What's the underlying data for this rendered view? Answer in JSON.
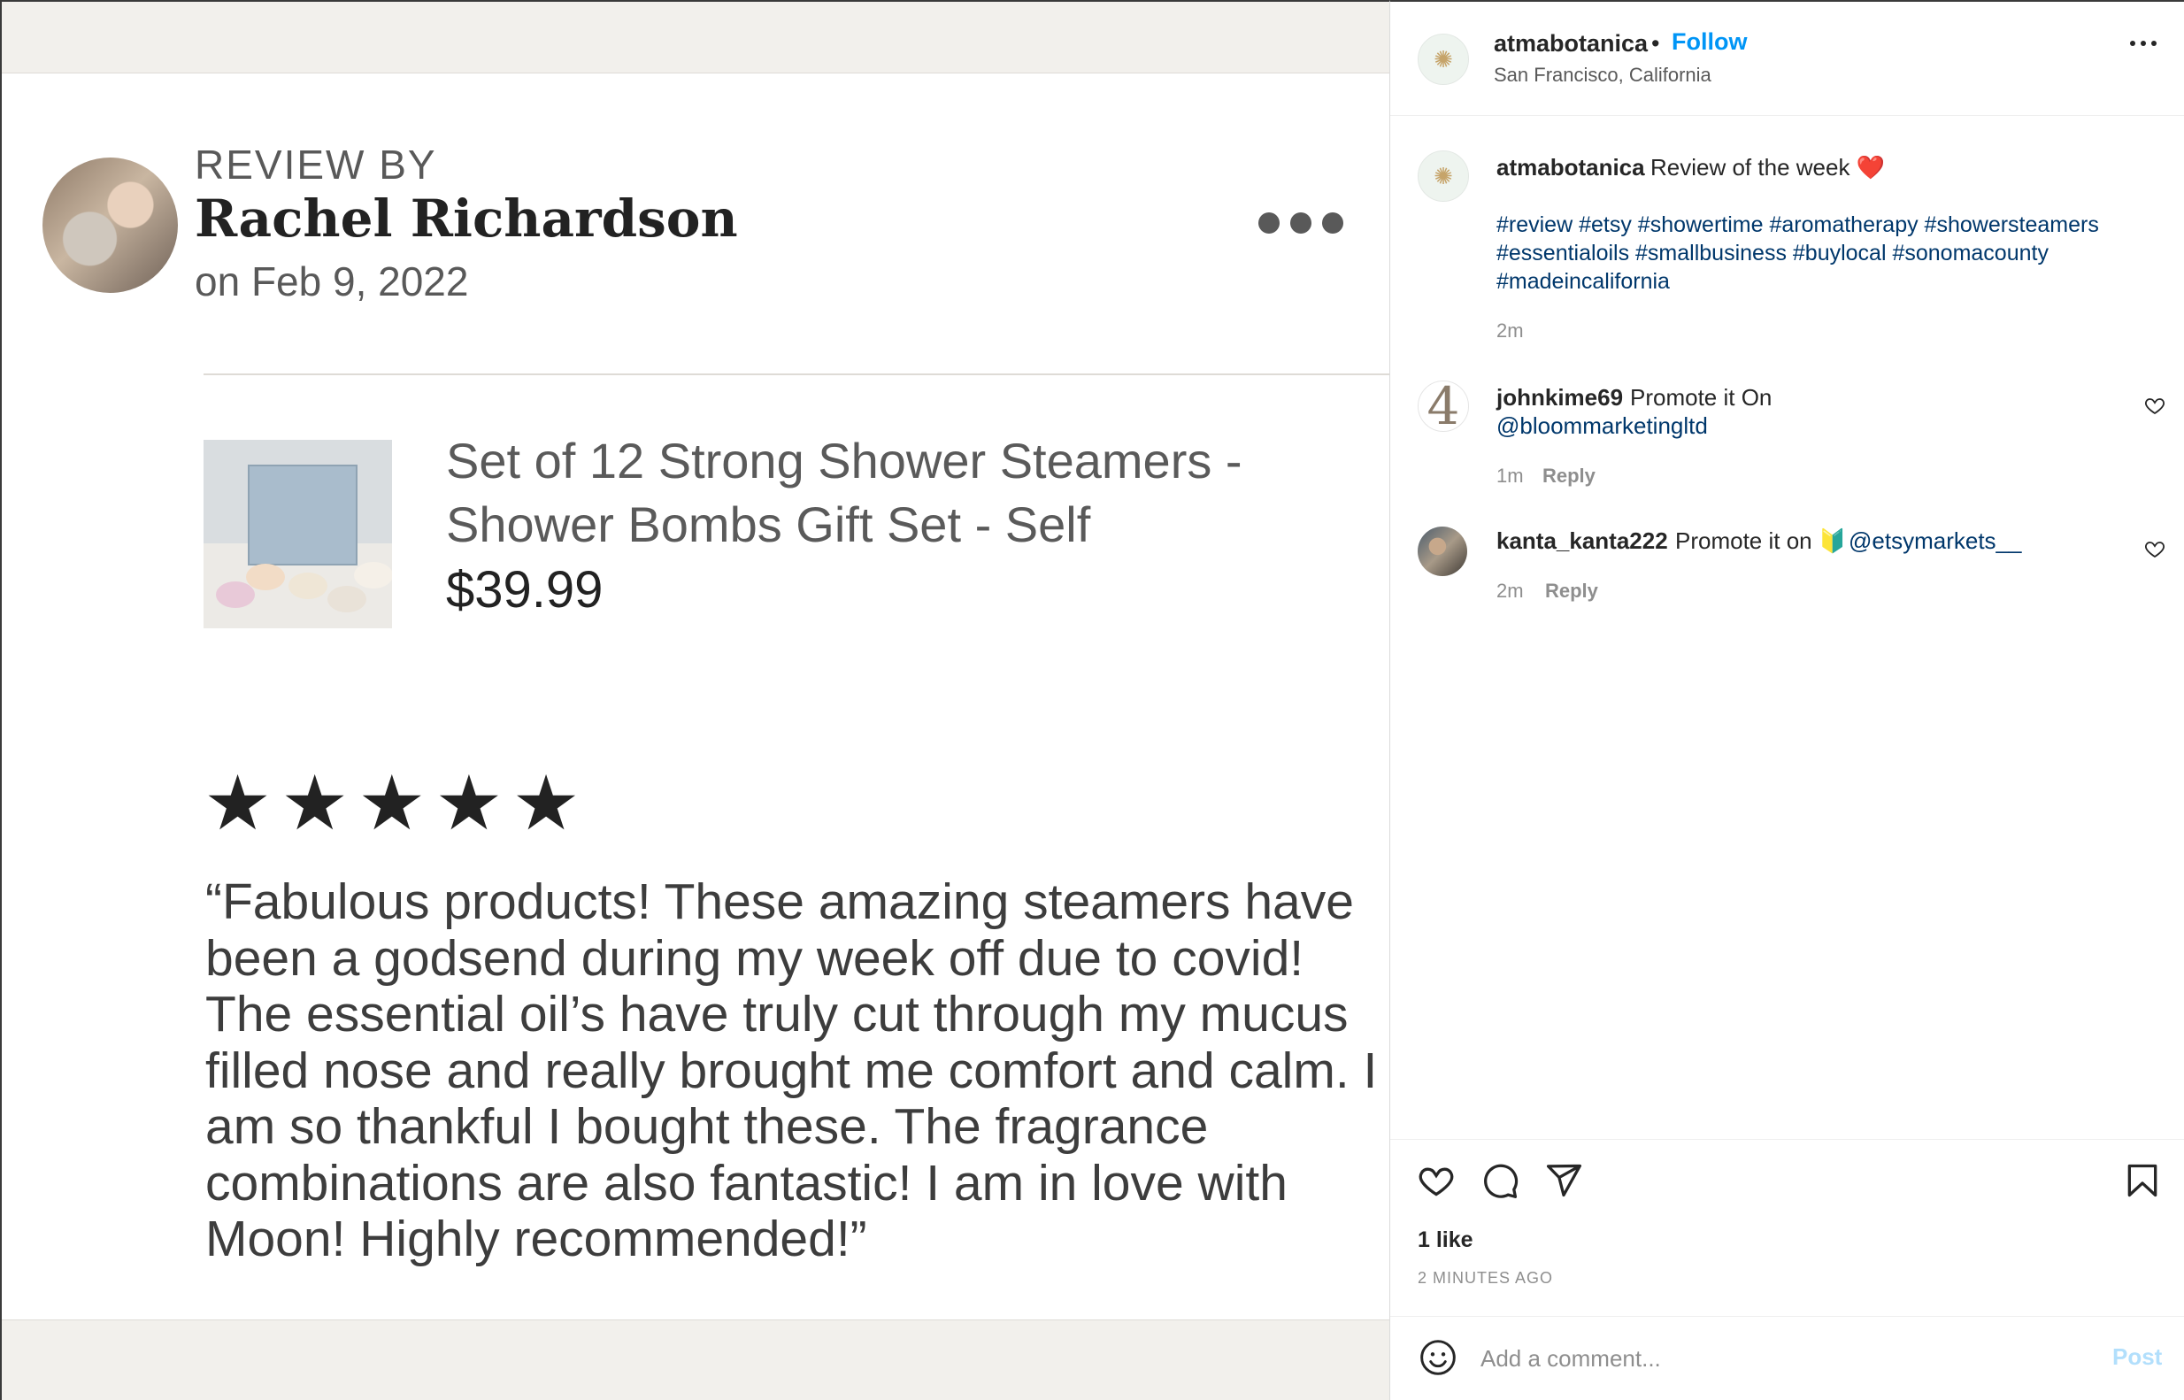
{
  "post_image": {
    "review_by_label": "REVIEW BY",
    "reviewer_name": "Rachel Richardson",
    "review_date": "on Feb 9, 2022",
    "product_title": "Set of 12 Strong Shower Steamers - Shower Bombs Gift Set - Self",
    "product_price": "$39.99",
    "rating": 5,
    "stars": [
      "★",
      "★",
      "★",
      "★",
      "★"
    ],
    "review_text": "“Fabulous products! These amazing steamers have been a godsend during my week off due to covid! The essential oil’s have truly cut through my mucus filled nose and really brought me comfort and calm. I am so thankful I bought these. The fragrance combinations are also fantastic! I am in love with Moon! Highly recommended!”"
  },
  "header": {
    "username": "atmabotanica",
    "separator": "•",
    "follow_label": "Follow",
    "location": "San Francisco, California",
    "more_icon": "more-horizontal-icon"
  },
  "caption": {
    "username": "atmabotanica",
    "text": "Review of the week ❤️",
    "hashtags": "#review #etsy #showertime #aromatherapy #showersteamers #essentialoils #smallbusiness #buylocal #sonomacounty #madeincalifornia",
    "time": "2m"
  },
  "comments": [
    {
      "username": "johnkime69",
      "text": "Promote it On",
      "mention": "@bloommarketingltd",
      "time": "1m",
      "reply_label": "Reply",
      "avatar_text": "4"
    },
    {
      "username": "kanta_kanta222",
      "text": "Promote it on 🔰",
      "mention": "@etsymarkets__",
      "time": "2m",
      "reply_label": "Reply"
    }
  ],
  "actions": {
    "like_icon": "heart-icon",
    "comment_icon": "comment-icon",
    "share_icon": "send-icon",
    "save_icon": "bookmark-icon"
  },
  "likes": "1 like",
  "post_age": "2 MINUTES AGO",
  "comment_box": {
    "placeholder": "Add a comment...",
    "post_label": "Post"
  },
  "colors": {
    "link_blue": "#0095f6",
    "hashtag_blue": "#00376b",
    "post_disabled": "#b2dffc",
    "muted_text": "#8e8e8e"
  }
}
